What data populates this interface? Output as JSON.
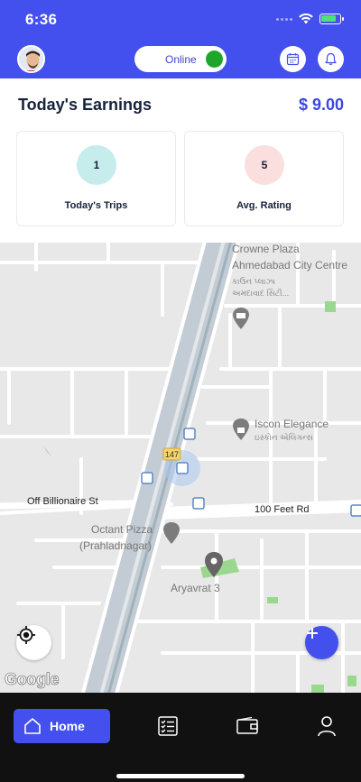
{
  "status_bar": {
    "time": "6:36"
  },
  "header": {
    "toggle_label": "Online",
    "colors": {
      "bar": "#4350ee",
      "online": "#1fa62a"
    },
    "icons": [
      "calendar-icon",
      "bell-icon"
    ]
  },
  "earnings": {
    "title": "Today's Earnings",
    "amount": "$ 9.00"
  },
  "stats": [
    {
      "value": "1",
      "label": "Today's Trips",
      "color": "#c7ecec"
    },
    {
      "value": "5",
      "label": "Avg. Rating",
      "color": "#fbdede"
    }
  ],
  "map": {
    "labels": {
      "crowne_1": "Crowne Plaza",
      "crowne_2": "Ahmedabad City Centre",
      "crowne_gu_1": "કાઉન પ્લાઝા",
      "crowne_gu_2": "અમદાવાદ સિટી...",
      "iscon": "Iscon Elegance",
      "iscon_gu": "ઇસ્કોન એલિગન્સ",
      "billionaire": "Off Billionaire St",
      "road_100": "100 Feet Rd",
      "octant_1": "Octant Pizza",
      "octant_2": "(Prahladnagar)",
      "aryavrat": "Aryavrat 3",
      "route": "147"
    },
    "attribution": "Google"
  },
  "nav": {
    "home_label": "Home",
    "icons": [
      "home-icon",
      "checklist-icon",
      "wallet-icon",
      "profile-icon"
    ]
  }
}
